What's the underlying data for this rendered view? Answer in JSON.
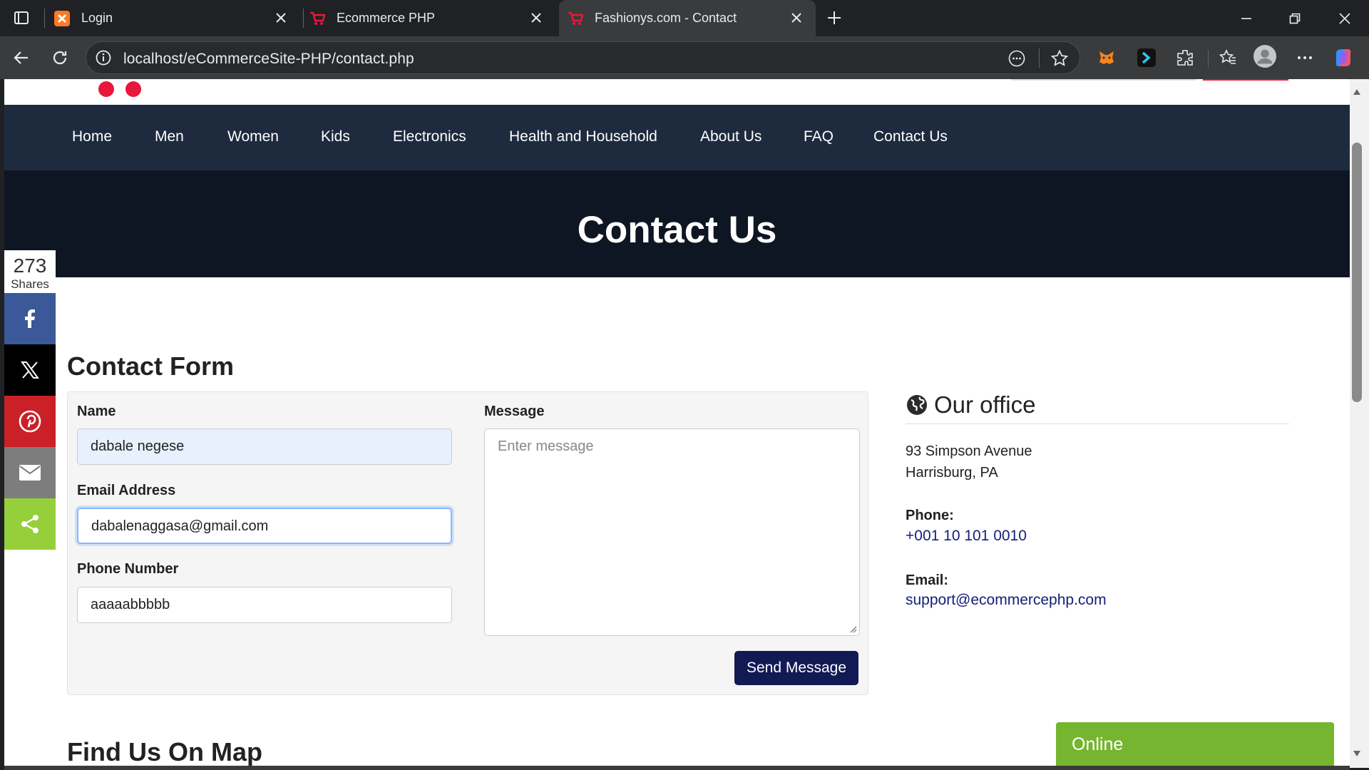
{
  "browser": {
    "tabs": [
      {
        "title": "Login"
      },
      {
        "title": "Ecommerce PHP"
      },
      {
        "title": "Fashionys.com - Contact"
      }
    ],
    "url": "localhost/eCommerceSite-PHP/contact.php"
  },
  "nav": {
    "items": [
      "Home",
      "Men",
      "Women",
      "Kids",
      "Electronics",
      "Health and Household",
      "About Us",
      "FAQ",
      "Contact Us"
    ]
  },
  "hero": {
    "title": "Contact Us"
  },
  "share": {
    "count": "273",
    "label": "Shares"
  },
  "contact_form": {
    "heading": "Contact Form",
    "name_label": "Name",
    "name_value": "dabale negese",
    "email_label": "Email Address",
    "email_value": "dabalenaggasa@gmail.com",
    "phone_label": "Phone Number",
    "phone_value": "aaaaabbbbb",
    "message_label": "Message",
    "message_placeholder": "Enter message",
    "send_label": "Send Message"
  },
  "office": {
    "title": "Our office",
    "address_line1": "93 Simpson Avenue",
    "address_line2": "Harrisburg, PA",
    "phone_label": "Phone:",
    "phone": "+001 10 101 0010",
    "email_label": "Email:",
    "email": "support@ecommercephp.com"
  },
  "map": {
    "heading": "Find Us On Map"
  },
  "chat": {
    "status": "Online"
  },
  "colors": {
    "navbar": "#1e2a3e",
    "hero": "#0f1623",
    "send_button": "#121a54",
    "online_badge": "#75b530",
    "facebook": "#3b5998",
    "twitter_x": "#000000",
    "pinterest": "#cb2027",
    "email_share": "#7d7d7d",
    "generic_share": "#95d03a"
  }
}
